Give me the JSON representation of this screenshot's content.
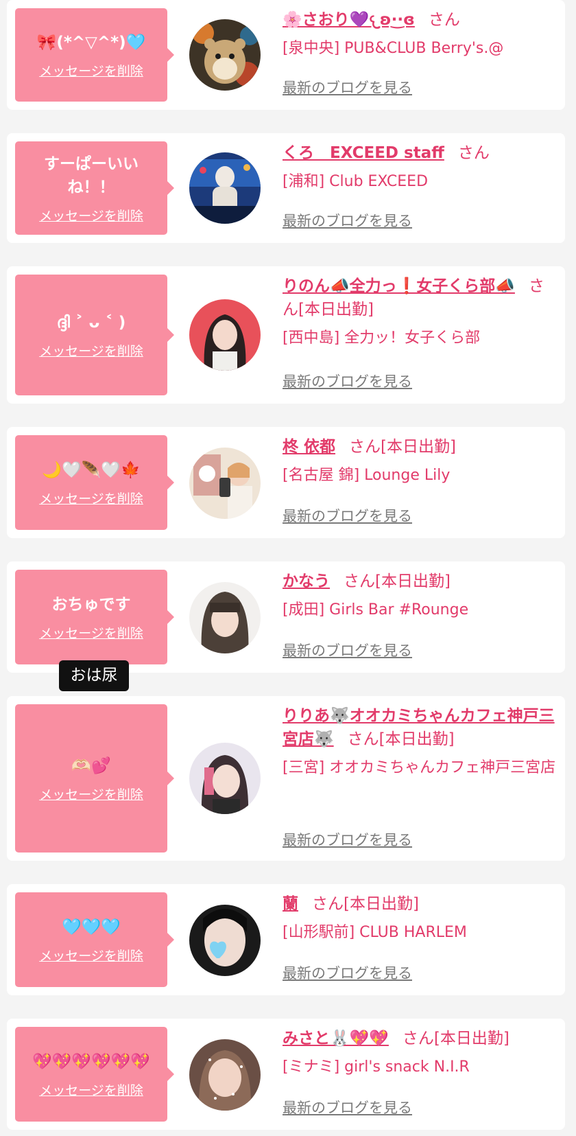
{
  "common": {
    "delete_label": "メッセージを削除",
    "blog_label": "最新のブログを見る",
    "san": "さん"
  },
  "colors": {
    "bubble": "#f98ea1",
    "accent": "#e23b6a",
    "link_gray": "#7a7a7a",
    "background": "#f4f4f4"
  },
  "tooltip": "おは尿",
  "items": [
    {
      "message": "🎀(*^▽^*)🩵",
      "name": "🌸さおり💜𐔌ʚ·͜·ɞ",
      "status": "",
      "shop": "[泉中央] PUB&CLUB Berry's.@",
      "avatar_icon": "hamster-plush-avatar"
    },
    {
      "message": "すーぱーいいね！！",
      "name": "くろ　EXCEED staff",
      "status": "",
      "shop": "[浦和] Club EXCEED",
      "avatar_icon": "aquarium-person-avatar"
    },
    {
      "message": "ദ്ദി ˃ ᴗ ˂ )",
      "name": "りのん📣全力っ❗️女子くら部📣",
      "status": "[本日出勤]",
      "shop": "[西中島] 全力ッ！女子くら部",
      "avatar_icon": "red-background-girl-avatar"
    },
    {
      "message": "🌙🤍🪶🤍🍁",
      "name": "柊 依都",
      "status": "[本日出勤]",
      "shop": "[名古屋 錦] Lounge Lily",
      "avatar_icon": "mirror-selfie-avatar"
    },
    {
      "message": "おちゅです",
      "name": "かなう",
      "status": "[本日出勤]",
      "shop": "[成田] Girls Bar #Rounge",
      "avatar_icon": "hooded-girl-avatar"
    },
    {
      "message": "🫶🏻💕",
      "name": "りりあ🐺オオカミちゃんカフェ神戸三宮店🐺",
      "status": "[本日出勤]",
      "shop": "[三宮] オオカミちゃんカフェ神戸三宮店",
      "avatar_icon": "wolf-cafe-girl-avatar"
    },
    {
      "message": "🩵🩵🩵",
      "name": "蘭",
      "status": "[本日出勤]",
      "shop": "[山形駅前] CLUB HARLEM",
      "avatar_icon": "heart-covered-face-avatar"
    },
    {
      "message": "💖💖💖💖💖💖",
      "name": "みさと🐰💖💖",
      "status": "[本日出勤]",
      "shop": "[ミナミ] girl's snack N.I.R",
      "avatar_icon": "sparkle-girl-avatar"
    }
  ]
}
